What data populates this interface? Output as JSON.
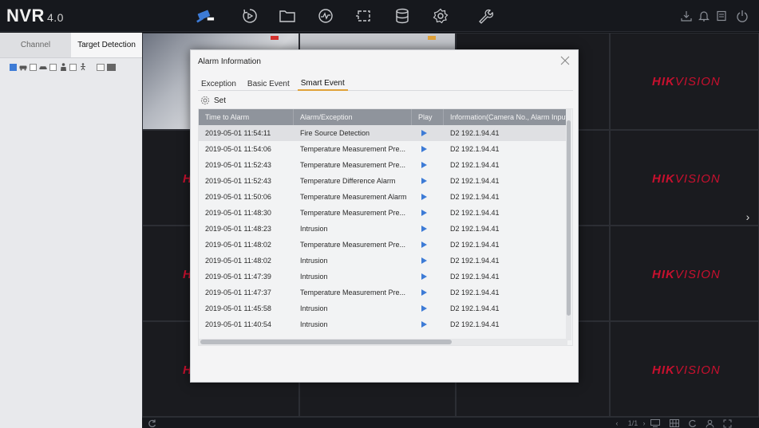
{
  "app": {
    "logo": "NVR",
    "version": "4.0"
  },
  "top_nav": [
    {
      "icon": "live-view-camera-icon"
    },
    {
      "icon": "playback-icon"
    },
    {
      "icon": "file-management-icon"
    },
    {
      "icon": "smart-analysis-icon"
    },
    {
      "icon": "camera-management-icon"
    },
    {
      "icon": "storage-icon"
    },
    {
      "icon": "configuration-gear-icon"
    },
    {
      "icon": "maintenance-wrench-icon"
    }
  ],
  "system_icons": [
    "download-icon",
    "alarm-bell-icon",
    "task-icon",
    "power-icon"
  ],
  "left_panel": {
    "tabs": [
      {
        "label": "Channel"
      },
      {
        "label": "Target Detection"
      }
    ],
    "filters": [
      "all-checkbox",
      "vehicle-filter-icon",
      "human-filter-icon"
    ]
  },
  "grid": {
    "brand_main": "HIK",
    "brand_rest": "VISION",
    "partial_brand_letter": "H"
  },
  "dialog": {
    "title": "Alarm Information",
    "tabs": [
      {
        "label": "Exception"
      },
      {
        "label": "Basic Event"
      },
      {
        "label": "Smart Event"
      }
    ],
    "active_tab": "Smart Event",
    "set_label": "Set",
    "columns": [
      "Time to Alarm",
      "Alarm/Exception",
      "Play",
      "Information(Camera No., Alarm Input No.)"
    ],
    "rows": [
      {
        "time": "2019-05-01 11:54:11",
        "alarm": "Fire Source Detection",
        "info": "D2 192.1.94.41"
      },
      {
        "time": "2019-05-01 11:54:06",
        "alarm": "Temperature Measurement Pre...",
        "info": "D2 192.1.94.41"
      },
      {
        "time": "2019-05-01 11:52:43",
        "alarm": "Temperature Measurement Pre...",
        "info": "D2 192.1.94.41"
      },
      {
        "time": "2019-05-01 11:52:43",
        "alarm": "Temperature Difference Alarm",
        "info": "D2 192.1.94.41"
      },
      {
        "time": "2019-05-01 11:50:06",
        "alarm": "Temperature Measurement Alarm",
        "info": "D2 192.1.94.41"
      },
      {
        "time": "2019-05-01 11:48:30",
        "alarm": "Temperature Measurement Pre...",
        "info": "D2 192.1.94.41"
      },
      {
        "time": "2019-05-01 11:48:23",
        "alarm": "Intrusion",
        "info": "D2 192.1.94.41"
      },
      {
        "time": "2019-05-01 11:48:02",
        "alarm": "Temperature Measurement Pre...",
        "info": "D2 192.1.94.41"
      },
      {
        "time": "2019-05-01 11:48:02",
        "alarm": "Intrusion",
        "info": "D2 192.1.94.41"
      },
      {
        "time": "2019-05-01 11:47:39",
        "alarm": "Intrusion",
        "info": "D2 192.1.94.41"
      },
      {
        "time": "2019-05-01 11:47:37",
        "alarm": "Temperature Measurement Pre...",
        "info": "D2 192.1.94.41"
      },
      {
        "time": "2019-05-01 11:45:58",
        "alarm": "Intrusion",
        "info": "D2 192.1.94.41"
      },
      {
        "time": "2019-05-01 11:40:54",
        "alarm": "Intrusion",
        "info": "D2 192.1.94.41"
      }
    ],
    "selected_row": 0
  },
  "bottom_bar": {
    "page_indicator": "1/1"
  },
  "colors": {
    "accent_tab": "#e0a23a",
    "play_icon": "#3d7bd6",
    "hikvision_red": "#c8102e",
    "header_gray": "#8f949c"
  }
}
